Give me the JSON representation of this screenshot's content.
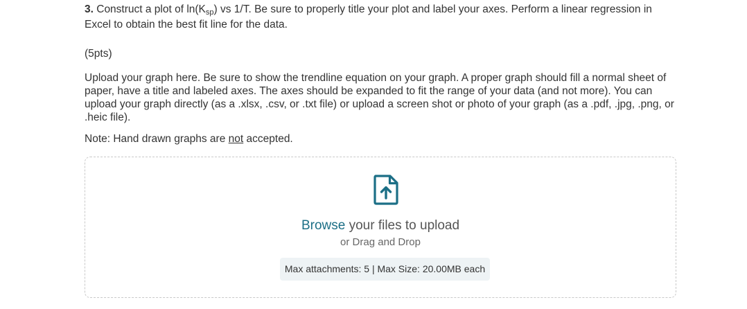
{
  "question": {
    "number": "3.",
    "text_before_sub": " Construct a plot of ln(K",
    "subscript": "sp",
    "text_after_sub": ") vs 1/T. Be sure to properly title your plot and label your axes. Perform a linear regression in Excel to obtain the best fit line for the data."
  },
  "points": "(5pts)",
  "instructions": "Upload your graph here. Be sure to show the trendline equation on your graph. A proper graph should fill a normal sheet of paper, have a title and labeled axes. The axes should be expanded to fit the range of your data (and not more). You can upload your graph directly (as a .xlsx, .csv, or .txt file) or upload a screen shot or photo of your graph (as a .pdf, .jpg, .png, or .heic file).",
  "note": {
    "prefix": "Note: Hand drawn graphs are ",
    "emphasis": "not",
    "suffix": " accepted."
  },
  "upload": {
    "icon": "file-upload-icon",
    "browse_label": "Browse",
    "browse_suffix": " your files to upload",
    "drag_label": "or Drag and Drop",
    "limits_label": "Max attachments: 5 | Max Size: 20.00MB each",
    "accent_color": "#1c6f86"
  }
}
